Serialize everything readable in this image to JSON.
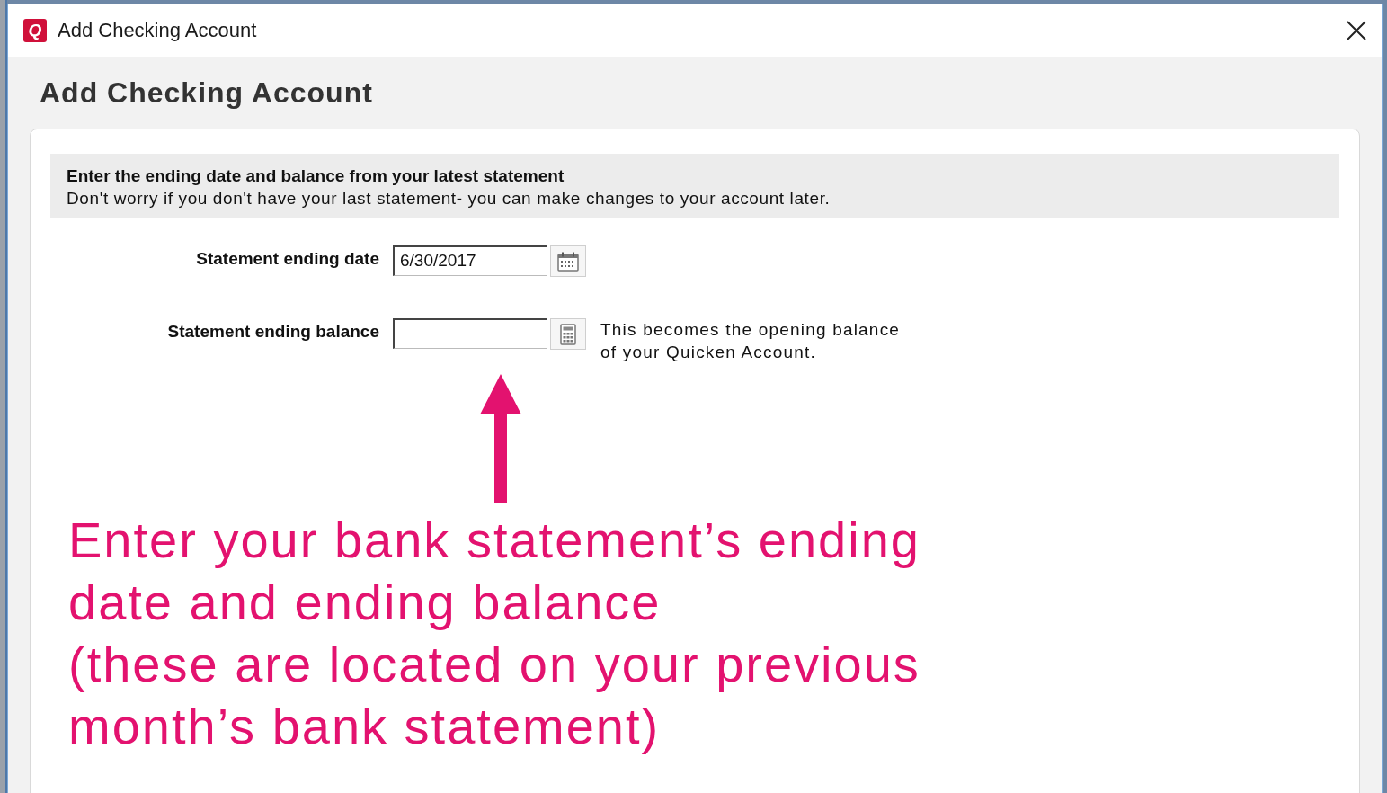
{
  "window": {
    "logo": "Q",
    "title": "Add Checking Account"
  },
  "heading": "Add Checking Account",
  "info_box": {
    "title": "Enter the ending date and balance from your latest statement",
    "text": "Don't worry if you don't have your last statement- you can make changes to your account later."
  },
  "fields": [
    {
      "kind": "date",
      "label": "Statement ending date",
      "value": "6/30/2017"
    },
    {
      "kind": "amount",
      "label": "Statement ending balance",
      "hint": "This becomes the opening balance of your Quicken Account."
    }
  ],
  "annotation": {
    "paragraphs": [
      "Enter your bank statement’s ending date and ending balance",
      "(these are located on your previous month’s bank statement)"
    ]
  }
}
